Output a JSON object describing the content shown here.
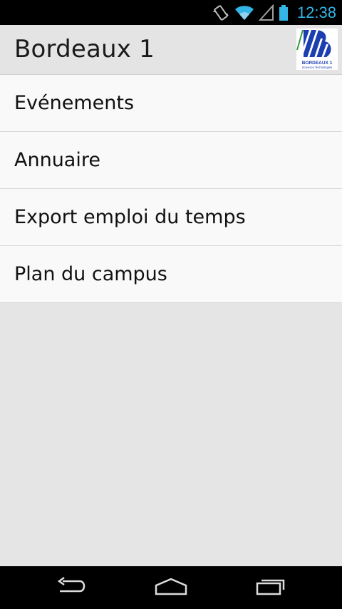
{
  "status_bar": {
    "time": "12:38",
    "icons": [
      "vibrate-icon",
      "wifi-icon",
      "signal-icon",
      "battery-icon"
    ]
  },
  "action_bar": {
    "title": "Bordeaux 1",
    "logo": {
      "text": "BORDEAUX 1",
      "subtext": "Sciences Technologies"
    }
  },
  "menu": {
    "items": [
      {
        "label": "Evénements"
      },
      {
        "label": "Annuaire"
      },
      {
        "label": "Export emploi du temps"
      },
      {
        "label": "Plan du campus"
      }
    ]
  },
  "nav_bar": {
    "icons": [
      "back-icon",
      "home-icon",
      "recent-apps-icon"
    ]
  },
  "colors": {
    "accent": "#33b5e5",
    "background": "#e5e5e5",
    "list_background": "#f9f9f9",
    "logo_blue": "#1b3fb0",
    "logo_green": "#2e9d3a"
  }
}
